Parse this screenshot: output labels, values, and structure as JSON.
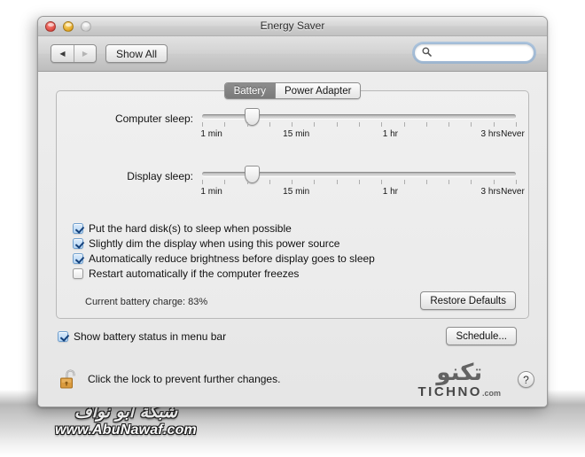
{
  "window": {
    "title": "Energy Saver",
    "traffic_lights": [
      "close",
      "minimize",
      "zoom"
    ]
  },
  "toolbar": {
    "back_glyph": "◀",
    "forward_glyph": "▶",
    "show_all_label": "Show All",
    "search_value": "",
    "search_placeholder": ""
  },
  "tabs": [
    {
      "label": "Battery",
      "active": true
    },
    {
      "label": "Power Adapter",
      "active": false
    }
  ],
  "sliders": [
    {
      "label": "Computer sleep:",
      "thumb_percent": 16,
      "tick_count": 15,
      "tick_labels": [
        {
          "text": "1 min",
          "percent": 3
        },
        {
          "text": "15 min",
          "percent": 30
        },
        {
          "text": "1 hr",
          "percent": 60
        },
        {
          "text": "3 hrs",
          "percent": 92
        },
        {
          "text": "Never",
          "percent": 99
        }
      ]
    },
    {
      "label": "Display sleep:",
      "thumb_percent": 16,
      "tick_count": 15,
      "tick_labels": [
        {
          "text": "1 min",
          "percent": 3
        },
        {
          "text": "15 min",
          "percent": 30
        },
        {
          "text": "1 hr",
          "percent": 60
        },
        {
          "text": "3 hrs",
          "percent": 92
        },
        {
          "text": "Never",
          "percent": 99
        }
      ]
    }
  ],
  "checkboxes": [
    {
      "label": "Put the hard disk(s) to sleep when possible",
      "checked": true
    },
    {
      "label": "Slightly dim the display when using this power source",
      "checked": true
    },
    {
      "label": "Automatically reduce brightness before display goes to sleep",
      "checked": true
    },
    {
      "label": "Restart automatically if the computer freezes",
      "checked": false
    }
  ],
  "battery": {
    "charge_text": "Current battery charge: 83%"
  },
  "buttons": {
    "restore_defaults": "Restore Defaults",
    "schedule": "Schedule...",
    "help": "?"
  },
  "menubar_option": {
    "label": "Show battery status in menu bar",
    "checked": true
  },
  "lock": {
    "state": "unlocked",
    "text": "Click the lock to prevent further changes."
  },
  "watermarks": {
    "tichno_arabic": "تكنو",
    "tichno_latin": "TICHNO",
    "tichno_domain": ".com",
    "abunawaf_arabic": "شبكة ابو نواف",
    "abunawaf_url": "www.AbuNawaf.com"
  },
  "colors": {
    "tab_active_bg": "#797979",
    "checkbox_checked": "#b7d6f3",
    "checkmark": "#16427c",
    "lock_body": "#d99a3e",
    "search_focus_ring": "#6ea5dc"
  }
}
